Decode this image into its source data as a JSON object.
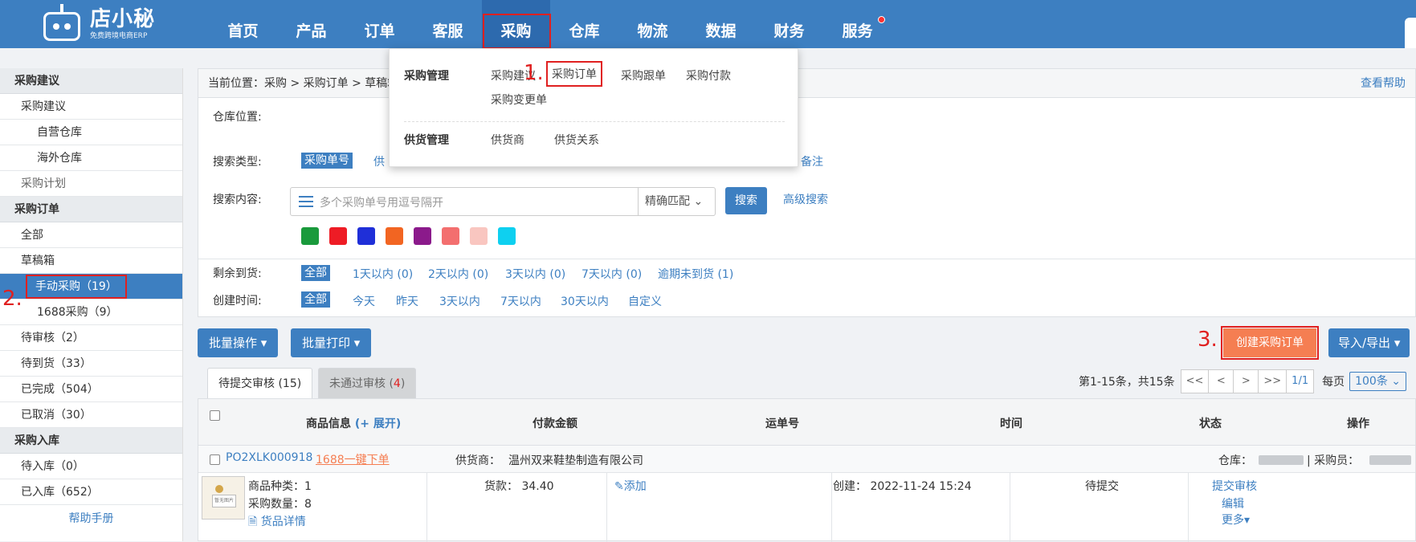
{
  "logo": {
    "name": "店小秘",
    "subtitle": "免费跨境电商ERP"
  },
  "nav": [
    "首页",
    "产品",
    "订单",
    "客服",
    "采购",
    "仓库",
    "物流",
    "数据",
    "财务",
    "服务"
  ],
  "dropdown": {
    "group1": "采购管理",
    "group1_links": [
      "采购建议",
      "采购订单",
      "采购跟单",
      "采购付款",
      "采购变更单"
    ],
    "group2": "供货管理",
    "group2_links": [
      "供货商",
      "供货关系"
    ]
  },
  "annotations": {
    "a1": "1.",
    "a2": "2.",
    "a3": "3."
  },
  "sidebar": {
    "sec1": "采购建议",
    "s1_items": [
      "采购建议",
      "自营仓库",
      "海外仓库",
      "采购计划"
    ],
    "sec2": "采购订单",
    "s2_items": [
      "全部",
      "草稿箱",
      "手动采购（19）",
      "1688采购（9）",
      "待审核（2）",
      "待到货（33）",
      "已完成（504）",
      "已取消（30）"
    ],
    "sec3": "采购入库",
    "s3_items": [
      "待入库（0）",
      "已入库（652）"
    ],
    "help": "帮助手册"
  },
  "breadcrumb": {
    "text": "当前位置：采购 > 采购订单 > 草稿箱",
    "help": "查看帮助"
  },
  "filters": {
    "warehouse_label": "仓库位置:",
    "search_type_label": "搜索类型:",
    "search_type_active": "采购单号",
    "search_type_partial": "供",
    "search_type_remark": "备注",
    "search_content_label": "搜索内容:",
    "search_placeholder": "多个采购单号用逗号隔开",
    "match_mode": "精确匹配",
    "search_btn": "搜索",
    "advanced": "高级搜索",
    "colors": [
      "#1a9a3c",
      "#ee1c25",
      "#1f2fd8",
      "#f26522",
      "#8b1a8b",
      "#f36f6f",
      "#f9c6c0",
      "#0ed0f0"
    ],
    "remain_label": "剩余到货:",
    "remain_opts": [
      "全部",
      "1天以内 (0)",
      "2天以内 (0)",
      "3天以内 (0)",
      "7天以内 (0)",
      "逾期未到货 (1)"
    ],
    "created_label": "创建时间:",
    "created_opts": [
      "全部",
      "今天",
      "昨天",
      "3天以内",
      "7天以内",
      "30天以内",
      "自定义"
    ]
  },
  "actions": {
    "batch_op": "批量操作 ▾",
    "batch_print": "批量打印 ▾",
    "create": "创建采购订单",
    "import_export": "导入/导出 ▾"
  },
  "tabs": {
    "pending": "待提交审核 (15)",
    "rejected_label": "未通过审核 (",
    "rejected_count": "4",
    "rejected_end": ")"
  },
  "pager": {
    "summary": "第1-15条，共15条",
    "first": "<<",
    "prev": "<",
    "next": ">",
    "last": ">>",
    "page": "1/1",
    "per_page_label": "每页",
    "per_page": "100条 ⌄"
  },
  "table": {
    "headers": {
      "goods": "商品信息",
      "expand": "(+ 展开)",
      "amount": "付款金额",
      "tracking": "运单号",
      "time": "时间",
      "status": "状态",
      "ops": "操作"
    },
    "order": {
      "no": "PO2XLK000918",
      "one_click": "1688一键下单",
      "supplier_label": "供货商：",
      "supplier": "温州双来鞋垫制造有限公司",
      "warehouse_label": "仓库：",
      "buyer_label": "| 采购员："
    },
    "row": {
      "thumb_text": "暂无图片",
      "kinds": "商品种类：1",
      "qty": "采购数量：8",
      "detail": "货品详情",
      "goods_amount": "货款：  34.40",
      "add": "添加",
      "created": "创建：  2022-11-24 15:24",
      "status": "待提交",
      "op_submit": "提交审核",
      "op_edit": "编辑",
      "op_more": "更多▾"
    }
  }
}
